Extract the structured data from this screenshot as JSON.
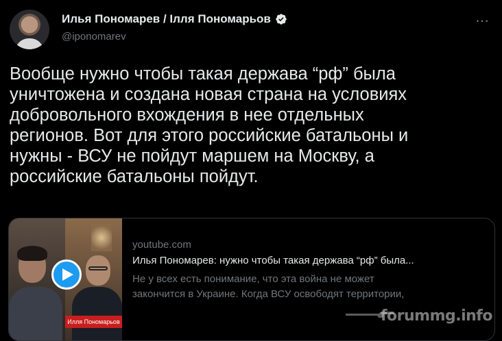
{
  "author": {
    "display_name": "Илья Пономарев / Ілля Пономарьов",
    "handle": "@iponomarev",
    "verified": true
  },
  "tweet": {
    "lines": [
      "Вообще нужно чтобы такая держава “рф” была",
      "уничтожена и создана новая страна на условиях",
      "добровольного вхождения в нее отдельных",
      "регионов. Вот для этого российские батальоны и",
      "нужны - ВСУ не пойдут маршем на Москву, а",
      "российские батальоны пойдут."
    ]
  },
  "card": {
    "domain": "youtube.com",
    "title": "Илья Пономарев: нужно чтобы такая держава “рф” была...",
    "description_lines": [
      "Не у всех есть понимание, что эта война не может",
      "закончится в Украине. Когда ВСУ освободят территории,"
    ],
    "thumbnail_caption": "Илля Пономарьов"
  },
  "watermark": "forummg.info",
  "icons": {
    "more": "more-options-icon",
    "verified": "verified-badge-icon",
    "play": "play-icon"
  },
  "colors": {
    "background": "#000000",
    "text": "#e7e9ea",
    "secondary": "#71767b",
    "accent": "#1d9bf0"
  }
}
